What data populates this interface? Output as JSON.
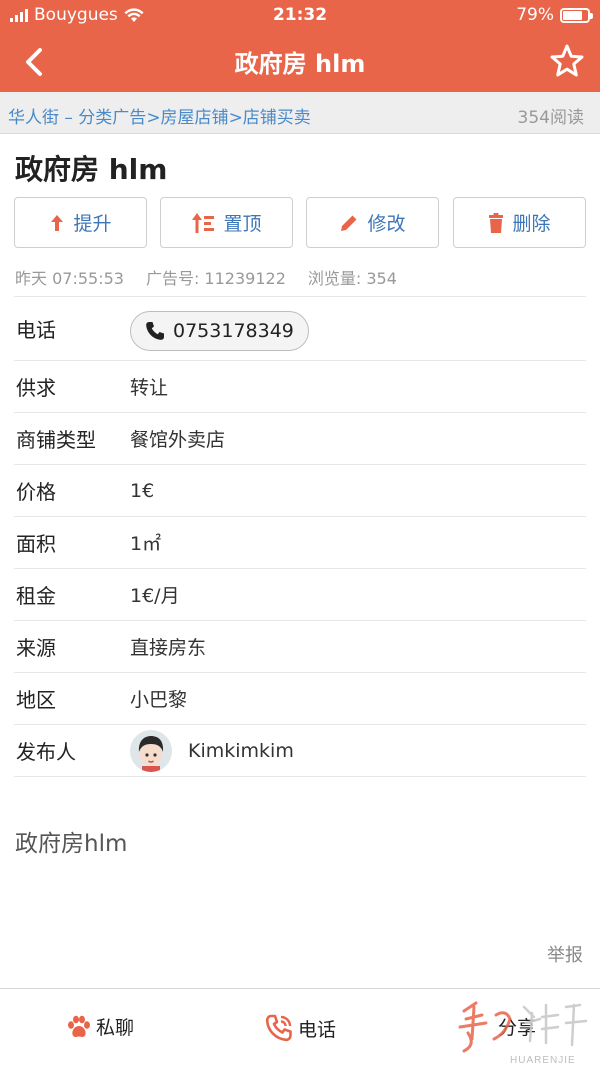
{
  "status_bar": {
    "carrier": "Bouygues",
    "time": "21:32",
    "battery": "79%",
    "battery_level": 0.79
  },
  "header": {
    "title": "政府房 hlm",
    "back_icon": "chevron-left-icon",
    "favorite_icon": "star-outline-icon",
    "background": "#e8654a"
  },
  "breadcrumb": {
    "items": [
      "华人街 – 分类广告",
      ">房屋店铺",
      ">店铺买卖"
    ],
    "reads": "354阅读",
    "link_color": "#4a8ac8"
  },
  "ad": {
    "title": "政府房 hlm",
    "actions": [
      {
        "label": "提升",
        "icon": "arrow-up-icon"
      },
      {
        "label": "置顶",
        "icon": "pin-top-icon"
      },
      {
        "label": "修改",
        "icon": "pencil-icon"
      },
      {
        "label": "删除",
        "icon": "trash-icon"
      }
    ],
    "meta": {
      "posted": "昨天 07:55:53",
      "ad_number": "广告号: 11239122",
      "views": "浏览量: 354"
    },
    "fields": [
      {
        "label": "电话",
        "value": "0753178349"
      },
      {
        "label": "供求",
        "value": "转让"
      },
      {
        "label": "商铺类型",
        "value": "餐馆外卖店"
      },
      {
        "label": "价格",
        "value": "1€"
      },
      {
        "label": "面积",
        "value": "1㎡"
      },
      {
        "label": "租金",
        "value": "1€/月"
      },
      {
        "label": "来源",
        "value": "直接房东"
      },
      {
        "label": "地区",
        "value": "小巴黎"
      },
      {
        "label": "发布人",
        "value": "Kimkimkim"
      }
    ],
    "description": "政府房hlm",
    "report": "举报"
  },
  "bottom_bar": {
    "items": [
      {
        "label": "私聊",
        "icon": "paw-icon"
      },
      {
        "label": "电话",
        "icon": "phone-icon"
      },
      {
        "label": "分享",
        "icon": "share-icon"
      }
    ],
    "watermark": "HUARENJIE"
  },
  "colors": {
    "accent": "#e8654a",
    "action_text": "#3d76b8",
    "action_icon": "#e8654a"
  }
}
